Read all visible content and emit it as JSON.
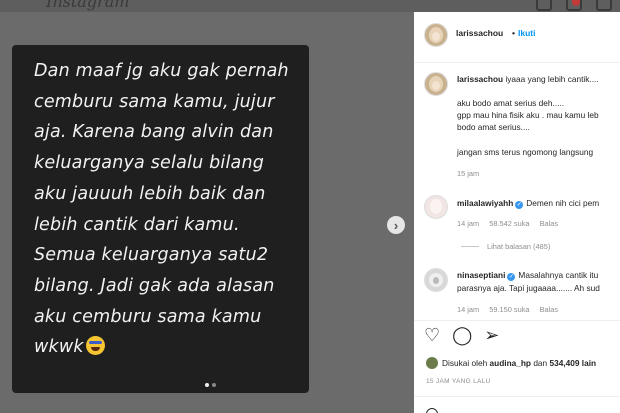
{
  "app": {
    "logo": "Instagram"
  },
  "story": {
    "lines": [
      "Dan maaf jg aku gak pernah",
      "cemburu sama kamu, jujur",
      "aja. Karena bang alvin dan",
      "keluarganya selalu bilang",
      "aku jauuuh lebih baik dan",
      "lebih cantik dari kamu.",
      "Semua keluarganya satu2",
      "bilang. Jadi gak ada alasan",
      "aku cemburu sama kamu",
      "wkwk"
    ],
    "emoji_name": "grinning-squinting-face-emoji"
  },
  "header": {
    "username": "larissachou",
    "separator": "•",
    "follow_label": "Ikuti"
  },
  "caption": {
    "username": "larissachou",
    "lines": [
      "iyaaa yang lebih cantik....",
      "aku bodo amat serius deh.....",
      "gpp mau hina fisik aku . mau kamu leb",
      "bodo amat serius....",
      "jangan sms terus ngomong langsung"
    ],
    "time": "15 jam"
  },
  "comments": [
    {
      "username": "milaalawiyahh",
      "verified": true,
      "text_lines": [
        "Demen nih cici pem"
      ],
      "time": "14 jam",
      "likes": "58.542 suka",
      "reply_label": "Balas",
      "view_replies": "Lihat balasan (485)"
    },
    {
      "username": "ninaseptiani",
      "verified": true,
      "text_lines": [
        "Masalahnya cantik itu",
        "parasnya aja. Tapi jugaaaa....... Ah sud"
      ],
      "time": "14 jam",
      "likes": "59.150 suka",
      "reply_label": "Balas"
    }
  ],
  "liked_by": {
    "prefix": "Disukai oleh ",
    "user": "audina_hp",
    "middle": " dan ",
    "count": "534,409 lain"
  },
  "post_time": "15 JAM YANG LALU",
  "icons": {
    "heart": "heart-icon",
    "comment": "comment-icon",
    "share": "share-icon",
    "next": "chevron-right-icon"
  },
  "colors": {
    "link_blue": "#0095f6",
    "verified": "#3897f0",
    "story_bg": "#1f1f1f"
  }
}
